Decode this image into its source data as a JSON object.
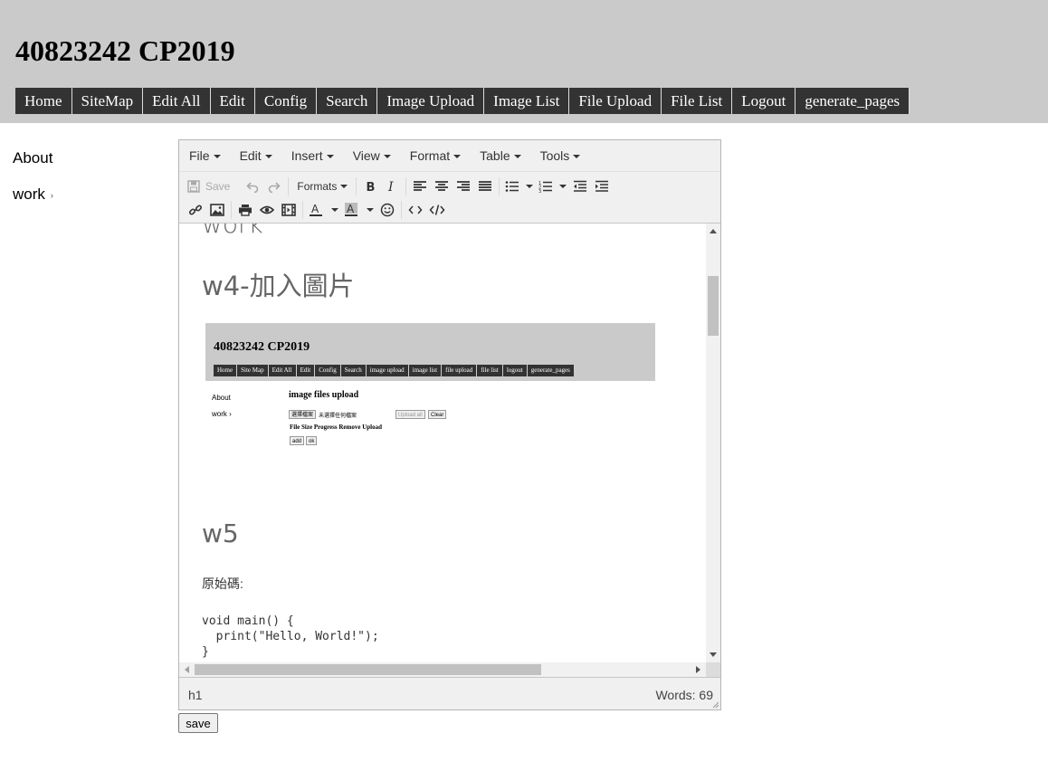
{
  "header": {
    "title": "40823242 CP2019",
    "nav": [
      "Home",
      "SiteMap",
      "Edit All",
      "Edit",
      "Config",
      "Search",
      "Image Upload",
      "Image List",
      "File Upload",
      "File List",
      "Logout",
      "generate_pages"
    ]
  },
  "sidebar": {
    "items": [
      {
        "label": "About"
      },
      {
        "label": "work",
        "arrow": "›"
      }
    ]
  },
  "editor": {
    "menubar": [
      "File",
      "Edit",
      "Insert",
      "View",
      "Format",
      "Table",
      "Tools"
    ],
    "toolbar": {
      "save_label": "Save",
      "formats_label": "Formats"
    },
    "content": {
      "partial_heading": "work",
      "heading_w4": "w4-加入圖片",
      "heading_w5": "w5",
      "paragraph": "原始碼:",
      "code": "void main() {\n  print(\"Hello, World!\");\n}"
    },
    "embedded_image": {
      "title": "40823242 CP2019",
      "nav": [
        "Home",
        "Site Map",
        "Edit All",
        "Edit",
        "Config",
        "Search",
        "image upload",
        "image list",
        "file upload",
        "file list",
        "logout",
        "generate_pages"
      ],
      "sidebar": [
        "About",
        "work ›"
      ],
      "upload_title": "image files upload",
      "choose_button": "選擇檔案",
      "no_file_text": "未選擇任何檔案",
      "upload_all": "Upload all",
      "clear": "Clear",
      "columns": "File Size Progress Remove Upload",
      "add": "add",
      "ok": "ok"
    },
    "statusbar": {
      "path": "h1",
      "wordcount": "Words: 69"
    }
  },
  "save_button": "save"
}
